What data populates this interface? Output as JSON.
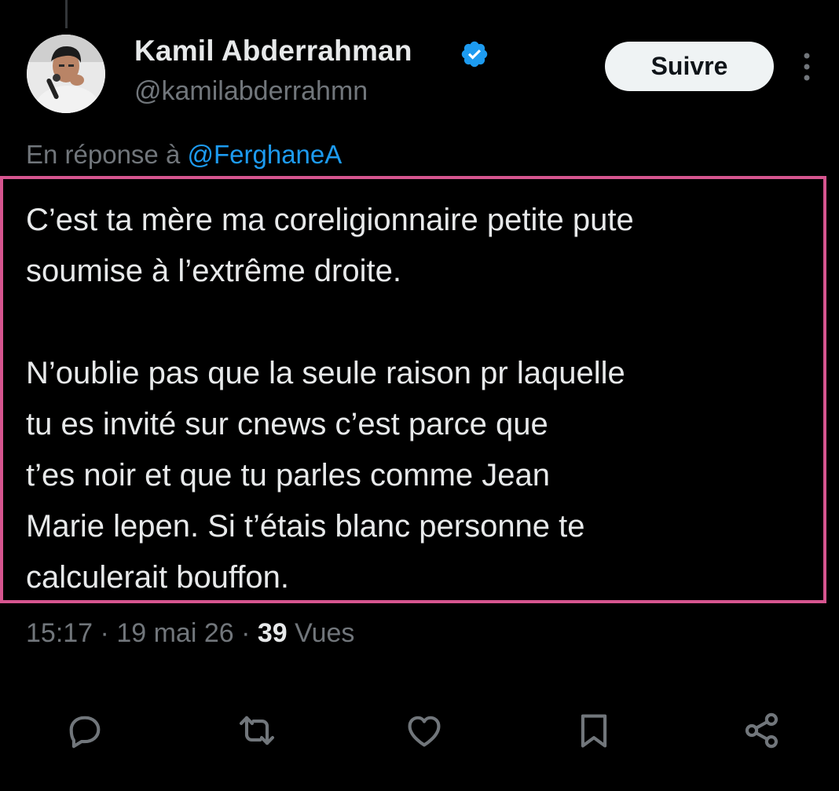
{
  "tweet": {
    "author": {
      "display_name": "Kamil Abderrahman",
      "handle": "@kamilabderrahmn",
      "verified": true,
      "avatar_icon": "avatar"
    },
    "follow_label": "Suivre",
    "more_icon": "more-vertical-icon",
    "reply_prefix": "En réponse à",
    "reply_mention": "@FerghaneA",
    "text_lines": [
      "C’est ta mère ma coreligionnaire petite pute",
      "soumise à l’extrême droite.",
      "N’oublie pas que la seule raison pr laquelle",
      "tu es invité sur cnews c’est parce que",
      "t’es noir et que tu parles comme Jean",
      "Marie lepen. Si t’étais blanc personne te",
      "calculerait bouffon."
    ],
    "time": "15:17",
    "separator": "·",
    "date": "19 mai 26",
    "views_count": "39",
    "views_label": "Vues",
    "actions": [
      "reply-icon",
      "retweet-icon",
      "like-icon",
      "bookmark-icon",
      "share-icon"
    ]
  },
  "colors": {
    "background": "#000000",
    "primary_text": "#e7e9ea",
    "secondary_text": "#71767b",
    "link": "#1d9bf0",
    "verified": "#1d9bf0",
    "highlight_border": "#d6558f",
    "follow_button_bg": "#eff3f4"
  }
}
